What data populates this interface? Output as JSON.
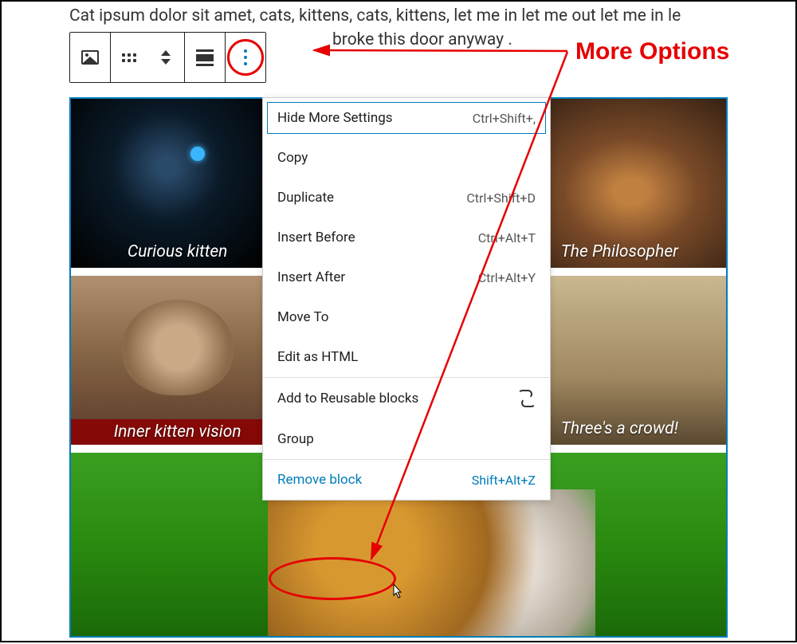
{
  "paragraph": "Cat ipsum dolor sit amet, cats, kittens, cats, kittens, let me in let me out let me in le",
  "paragraph_line2": "broke this door anyway .",
  "annotation_label": "More Options",
  "toolbar": {
    "image_icon": "image-icon",
    "drag_icon": "drag-icon",
    "move_icon": "move-icon",
    "align_icon": "align-icon",
    "more_icon": "more-icon"
  },
  "close_label": "✕",
  "gallery": [
    {
      "caption": "Curious kitten"
    },
    {
      "caption": ""
    },
    {
      "caption": "The Philosopher"
    },
    {
      "caption": "Inner kitten vision"
    },
    {
      "caption": ""
    },
    {
      "caption": "Three's a crowd!"
    },
    {
      "caption": ""
    }
  ],
  "menu": {
    "items": [
      {
        "label": "Hide More Settings",
        "shortcut": "Ctrl+Shift+,"
      },
      {
        "label": "Copy",
        "shortcut": ""
      },
      {
        "label": "Duplicate",
        "shortcut": "Ctrl+Shift+D"
      },
      {
        "label": "Insert Before",
        "shortcut": "Ctrl+Alt+T"
      },
      {
        "label": "Insert After",
        "shortcut": "Ctrl+Alt+Y"
      },
      {
        "label": "Move To",
        "shortcut": ""
      },
      {
        "label": "Edit as HTML",
        "shortcut": ""
      }
    ],
    "group2": [
      {
        "label": "Add to Reusable blocks",
        "shortcut": ""
      },
      {
        "label": "Group",
        "shortcut": ""
      }
    ],
    "remove": {
      "label": "Remove block",
      "shortcut": "Shift+Alt+Z"
    }
  }
}
